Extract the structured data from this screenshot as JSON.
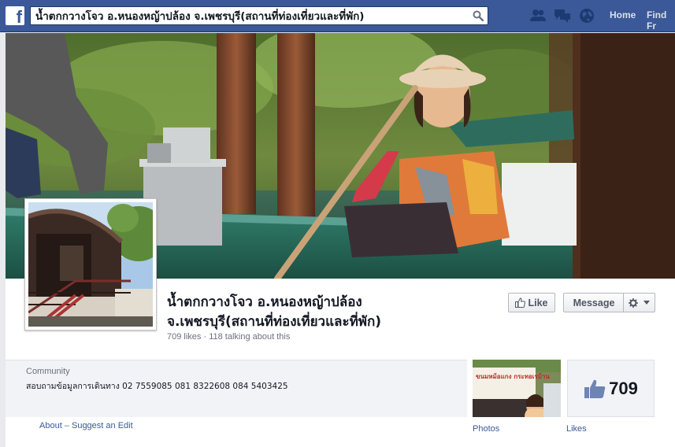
{
  "topbar": {
    "logo": "f",
    "search_value": "น้ำตกกวางโจว อ.หนองหญ้าปล้อง จ.เพชรบุรี(สถานที่ท่องเที่ยวและที่พัก)",
    "nav": {
      "home": "Home",
      "find_friends": "Find Fr"
    },
    "icons": [
      "friend-requests-icon",
      "messages-icon",
      "notifications-globe-icon",
      "search-icon"
    ],
    "bar_color": "#3b5998"
  },
  "page": {
    "title": "น้ำตกกวางโจว อ.หนองหญ้าปล้อง จ.เพชรบุรี(สถานที่ท่องเที่ยวและที่พัก)",
    "title_line1": "น้ำตกกวางโจว อ.หนองหญ้าปล้อง",
    "title_line2": "จ.เพชรบุรี(สถานที่ท่องเที่ยวและที่พัก)",
    "stats": "709 likes · 118 talking about this",
    "buttons": {
      "like": "Like",
      "message": "Message"
    },
    "info": {
      "category": "Community",
      "description": "สอบถามข้อมูลการเดินทาง 02 7559085 081 8322608 084 5403425"
    },
    "links": {
      "about": "About",
      "separator": " – ",
      "suggest_edit": "Suggest an Edit"
    },
    "photos_label": "Photos",
    "likes_label": "Likes",
    "likes_count": "709",
    "photo_sign_text": "ขนมหม้อแกง กระทอเรบ้าน"
  },
  "colors": {
    "brand": "#3b5998",
    "background": "#e9eaed",
    "link": "#3b5998"
  }
}
